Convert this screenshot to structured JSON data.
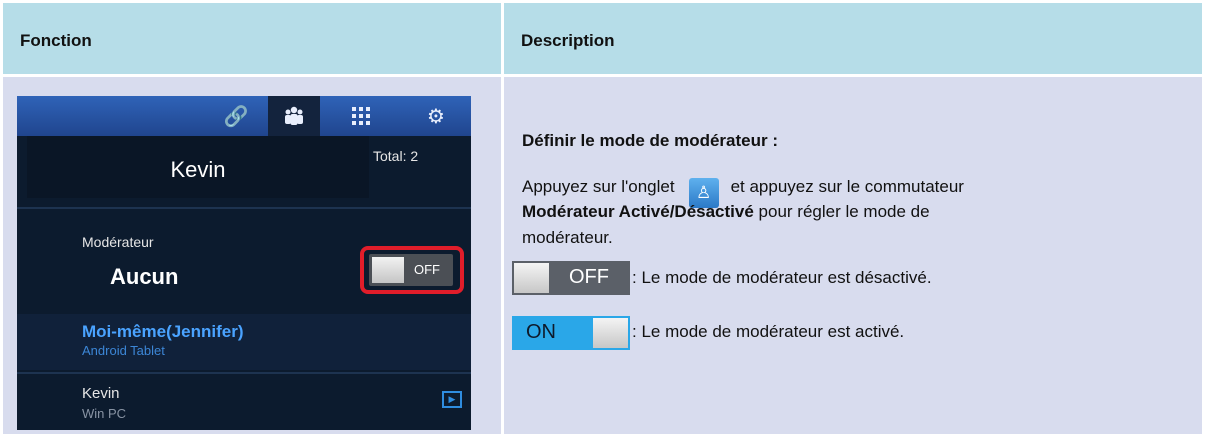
{
  "header": {
    "col1": "Fonction",
    "col2": "Description"
  },
  "phone": {
    "tabs": [
      "link-icon",
      "people-icon",
      "grid-icon",
      "settings-icon"
    ],
    "active_tab": "people-icon",
    "user_name": "Kevin",
    "total": "Total: 2",
    "moderator_label": "Modérateur",
    "moderator_value": "Aucun",
    "switch_state": "OFF",
    "highlight_color": "#e11d2a",
    "participants": [
      {
        "name": "Moi-même(Jennifer)",
        "device": "Android Tablet"
      },
      {
        "name": "Kevin",
        "device": "Win PC"
      }
    ]
  },
  "description": {
    "title": "Définir le mode de modérateur :",
    "line1_a": "Appuyez sur l'onglet",
    "line1_b": "et appuyez sur le commutateur",
    "line2_bold": "Modérateur Activé/Désactivé",
    "line2_rest": "pour régler le mode de",
    "line3": "modérateur.",
    "off_label": "OFF",
    "off_text": ": Le mode de modérateur est désactivé.",
    "on_label": "ON",
    "on_text": ": Le mode de modérateur est activé."
  }
}
